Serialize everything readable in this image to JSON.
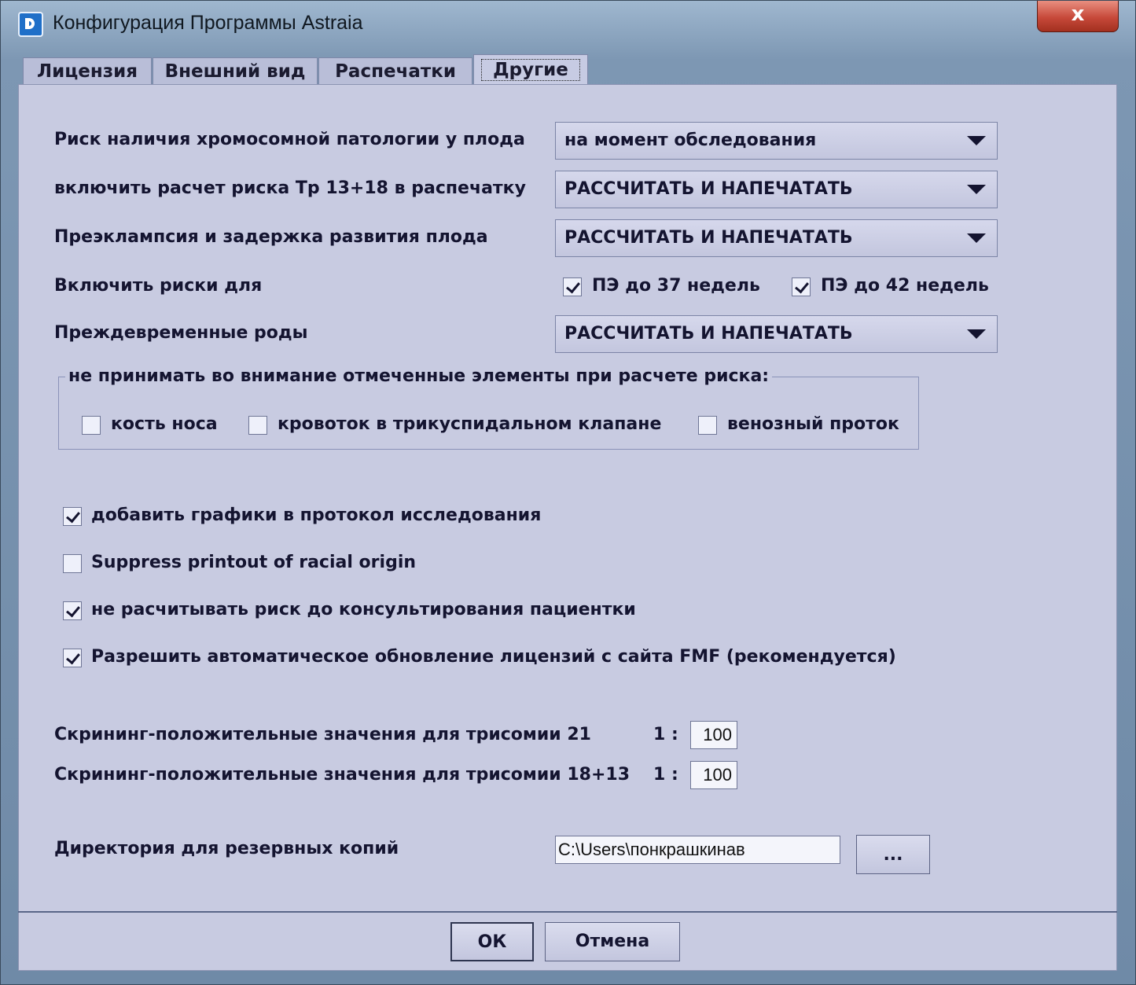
{
  "window": {
    "title": "Конфигурация Программы Astraia",
    "close_label": "x"
  },
  "tabs": [
    {
      "label": "Лицензия"
    },
    {
      "label": "Внешний вид"
    },
    {
      "label": "Распечатки"
    },
    {
      "label": "Другие"
    }
  ],
  "rows": {
    "chrom_risk": {
      "label": "Риск наличия хромосомной патологии у плода",
      "value": "на момент обследования"
    },
    "tr13_18": {
      "label": "включить расчет риска Тр 13+18 в распечатку",
      "value": "РАССЧИТАТЬ И НАПЕЧАТАТЬ"
    },
    "preeclampsia": {
      "label": "Преэклампсия и задержка развития плода",
      "value": "РАССЧИТАТЬ И НАПЕЧАТАТЬ"
    },
    "include_risks": {
      "label": "Включить риски для",
      "pe37": "ПЭ до 37 недель",
      "pe42": "ПЭ до 42 недель"
    },
    "preterm": {
      "label": "Преждевременные роды",
      "value": "РАССЧИТАТЬ И НАПЕЧАТАТЬ"
    }
  },
  "exclude_group": {
    "title": "не принимать во внимание отмеченные элементы при расчете риска:",
    "items": [
      "кость носа",
      "кровоток в трикуспидальном клапане",
      "венозный проток"
    ]
  },
  "options": [
    {
      "label": "добавить графики в протокол исследования"
    },
    {
      "label": "Suppress printout of racial origin"
    },
    {
      "label": "не расчитывать риск до консультирования пациентки"
    },
    {
      "label": "Разрешить автоматическое обновление лицензий с сайта FMF (рекомендуется)"
    }
  ],
  "screening": {
    "t21_label": "Скрининг-положительные значения для трисомии 21",
    "t1813_label": "Скрининг-положительные значения для трисомии 18+13",
    "ratio_prefix": "1 :",
    "t21_value": "100",
    "t1813_value": "100"
  },
  "backup": {
    "label": "Директория для резервных копий",
    "path": "C:\\Users\\понкрашкинав",
    "browse_label": "..."
  },
  "buttons": {
    "ok": "ОК",
    "cancel": "Отмена"
  }
}
